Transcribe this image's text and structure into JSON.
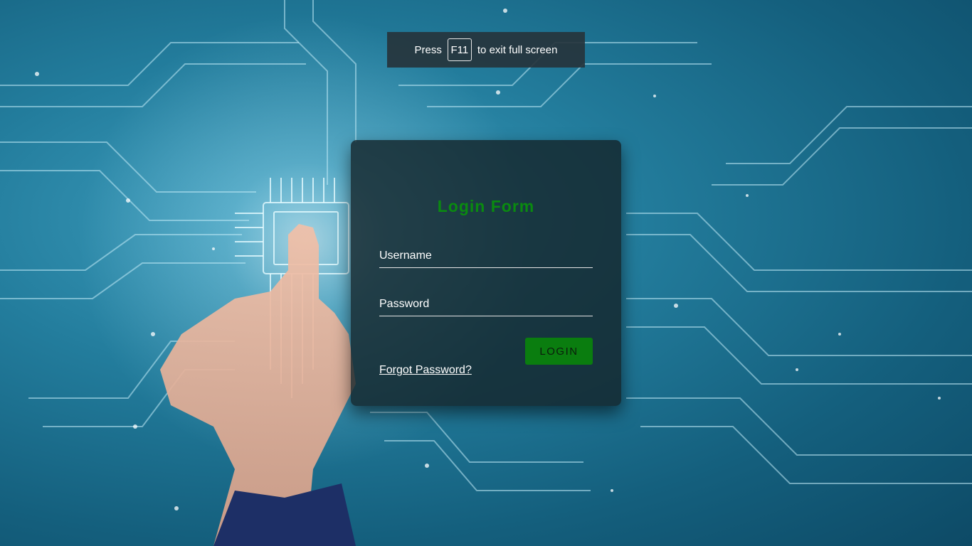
{
  "fullscreen_hint": {
    "prefix": "Press",
    "key": "F11",
    "suffix": "to exit full screen"
  },
  "login_form": {
    "title": "Login Form",
    "username_placeholder": "Username",
    "password_placeholder": "Password",
    "login_label": "LOGIN",
    "forgot_label": "Forgot Password?"
  },
  "colors": {
    "title_green": "#0a8a10",
    "button_green": "#0a7d0f",
    "background_teal": "#237d9d"
  },
  "background": {
    "description_icon": "circuit-board-hand-background"
  }
}
